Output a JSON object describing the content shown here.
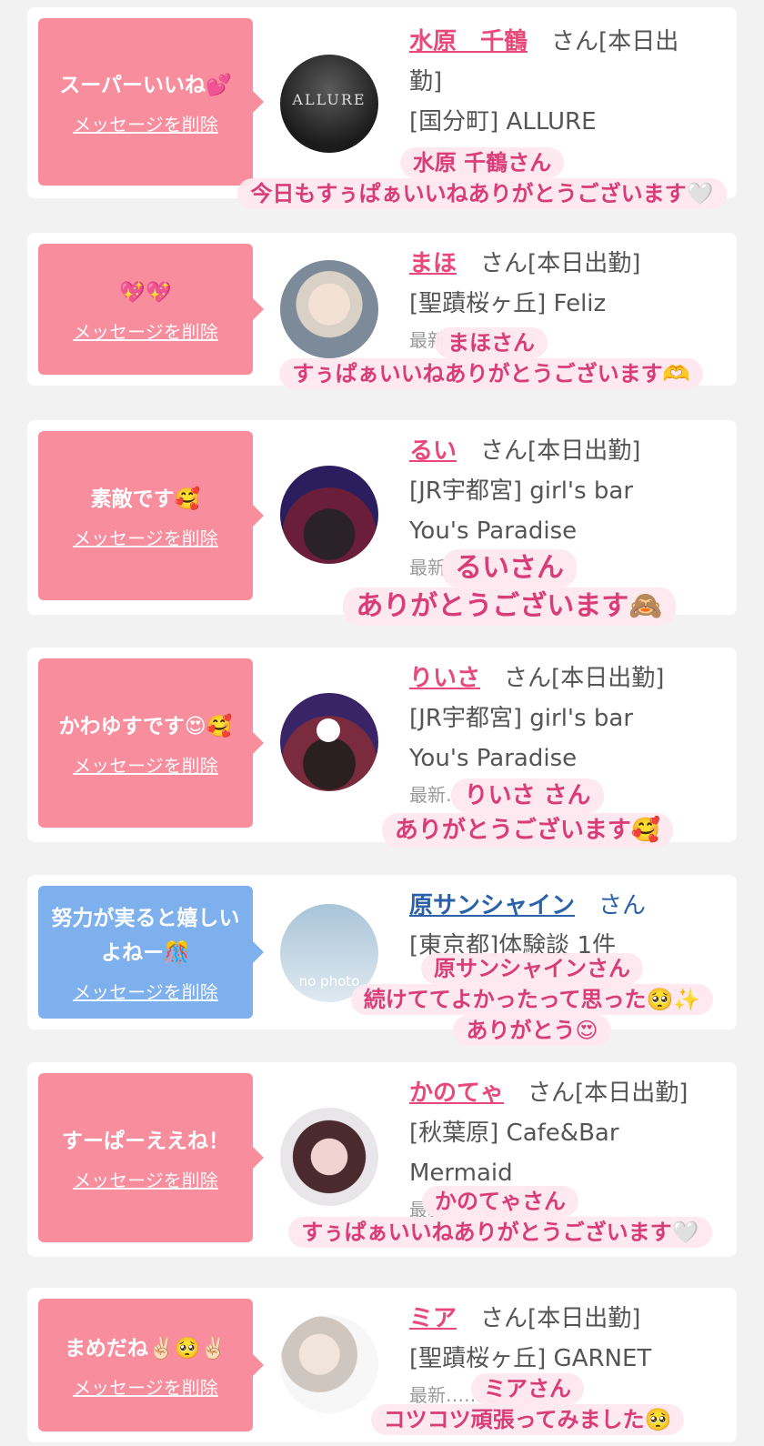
{
  "delete_label": "メッセージを削除",
  "san_suffix": "さん",
  "items": [
    {
      "bubble_text": "スーパーいいね💕",
      "name": "水原　千鶴",
      "status": "[本日出",
      "status2": "勤]",
      "shop_line1": "[国分町] ALLURE",
      "shop_line2": "",
      "hidden_line": "最新……を見る",
      "avatar_text": "ALLURE",
      "caption_name": "水原 千鶴さん",
      "caption_lines": [
        "今日もすぅぱぁいいねありがとうございます🤍"
      ]
    },
    {
      "bubble_text": "💖💖",
      "name": "まほ",
      "status": "[本日出勤]",
      "shop_line1": "[聖蹟桜ヶ丘] Feliz",
      "shop_line2": "",
      "hidden_line": "最新……を見る",
      "avatar_text": "",
      "caption_name": "まほさん",
      "caption_lines": [
        "すぅぱぁいいねありがとうございます🫶"
      ]
    },
    {
      "bubble_text": "素敵です🥰",
      "name": "るい",
      "status": "[本日出勤]",
      "shop_line1": "[JR宇都宮] girl's bar",
      "shop_line2": "You's Paradise",
      "hidden_line": "最新……を見る",
      "avatar_text": "",
      "caption_name": "るいさん",
      "caption_lines": [
        "ありがとうございます🙈"
      ]
    },
    {
      "bubble_text": "かわゆすです😍🥰",
      "name": "りいさ",
      "status": "[本日出勤]",
      "shop_line1": "[JR宇都宮] girl's bar",
      "shop_line2": "You's Paradise",
      "hidden_line": "最新……を見る",
      "avatar_text": "",
      "caption_name": "りいさ さん",
      "caption_lines": [
        "ありがとうございます🥰"
      ]
    },
    {
      "bubble_text": "努力が実ると嬉しいよねー🎊",
      "name": "原サンシャイン",
      "status": "",
      "shop_line1": "[東京都]体験談 1件",
      "shop_line2": "",
      "hidden_line": "",
      "avatar_text": "no photo",
      "caption_name": "原サンシャインさん",
      "caption_lines": [
        "続けててよかったって思った🥺✨",
        "ありがとう😍"
      ]
    },
    {
      "bubble_text": "すーぱーええね！",
      "name": "かのてゃ",
      "status": "[本日出勤]",
      "shop_line1": "[秋葉原] Cafe&Bar",
      "shop_line2": "Mermaid",
      "hidden_line": "最新……を見る",
      "avatar_text": "",
      "caption_name": "かのてゃさん",
      "caption_lines": [
        "すぅぱぁいいねありがとうございます🤍"
      ]
    },
    {
      "bubble_text": "まめだね✌🏻🥺✌🏻",
      "name": "ミア",
      "status": "[本日出勤]",
      "shop_line1": "[聖蹟桜ヶ丘] GARNET",
      "shop_line2": "",
      "hidden_line": "最新……を見る",
      "avatar_text": "",
      "caption_name": "ミアさん",
      "caption_lines": [
        "コツコツ頑張ってみました🥺"
      ]
    }
  ]
}
